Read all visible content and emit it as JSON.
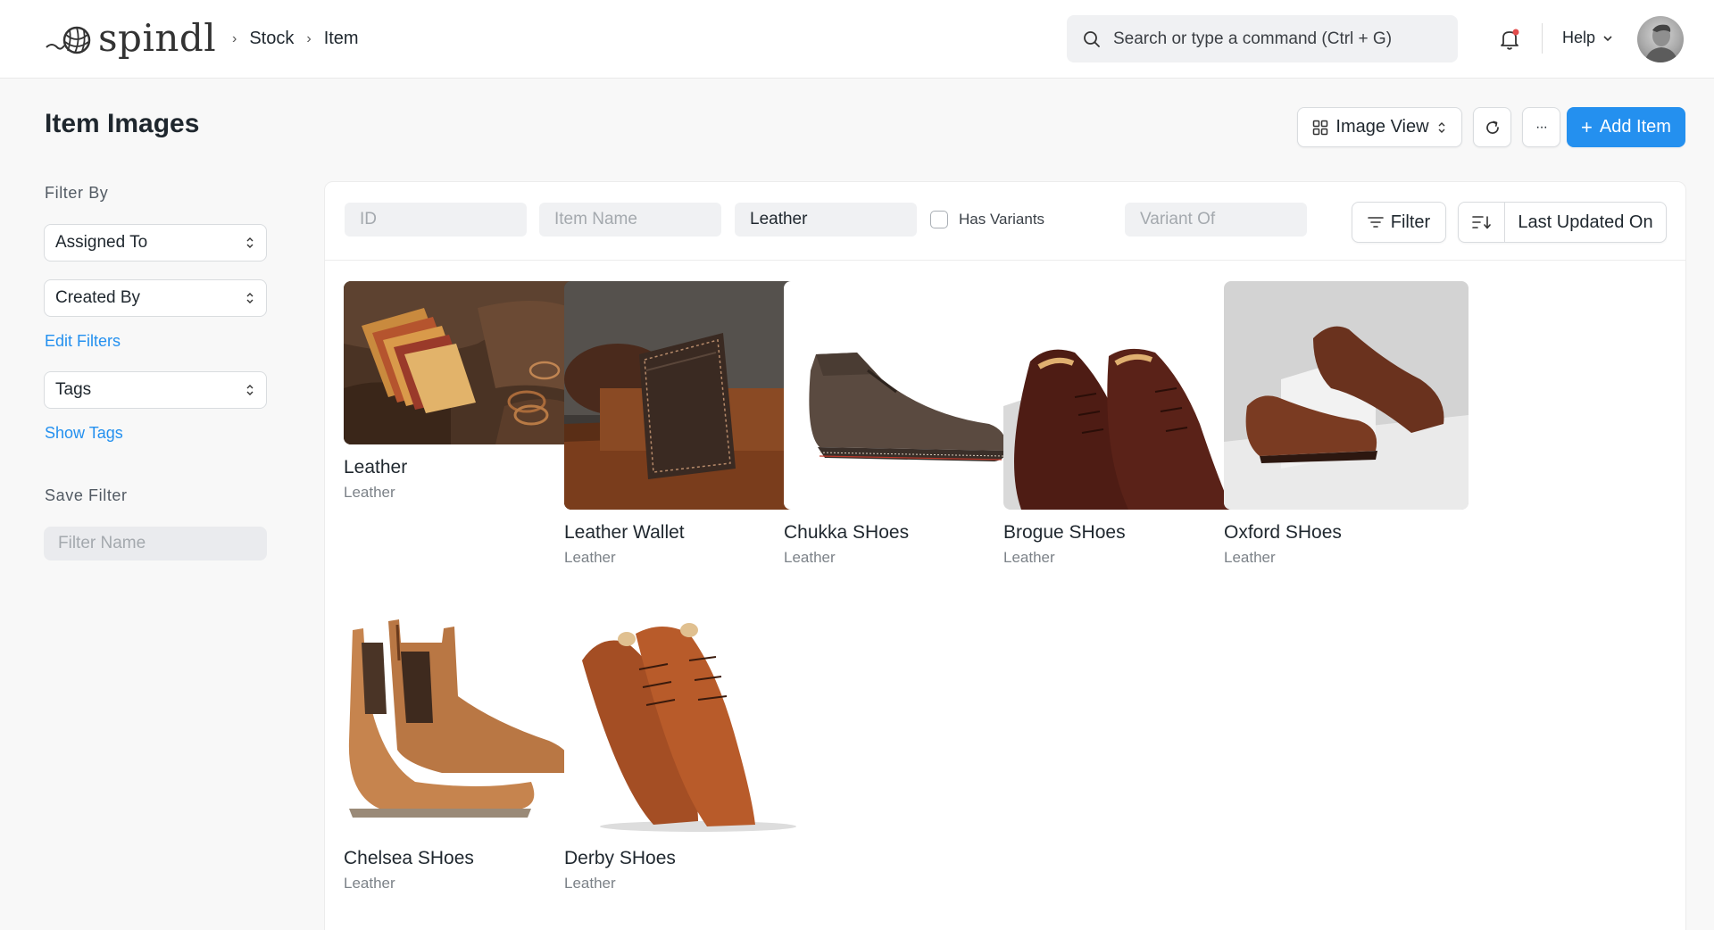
{
  "navbar": {
    "logo_text": "spindl",
    "breadcrumbs": [
      "Stock",
      "Item"
    ],
    "search_placeholder": "Search or type a command (Ctrl + G)",
    "help_label": "Help"
  },
  "page": {
    "title": "Item Images",
    "view_button": "Image View",
    "add_button": "Add Item",
    "more_label": "···",
    "accent_color": "#2490ef"
  },
  "sidebar": {
    "filter_by_label": "Filter By",
    "assigned_to": "Assigned To",
    "created_by": "Created By",
    "edit_filters": "Edit Filters",
    "tags": "Tags",
    "show_tags": "Show Tags",
    "save_filter_label": "Save Filter",
    "filter_name_placeholder": "Filter Name"
  },
  "filters": {
    "id_placeholder": "ID",
    "item_name_placeholder": "Item Name",
    "item_group_value": "Leather",
    "has_variants_label": "Has Variants",
    "variant_of_placeholder": "Variant Of",
    "filter_button": "Filter",
    "sort_by": "Last Updated On"
  },
  "items": [
    {
      "name": "Leather",
      "group": "Leather",
      "image": "leather-hides"
    },
    {
      "name": "Leather Wallet",
      "group": "Leather",
      "image": "leather-wallet"
    },
    {
      "name": "Chukka SHoes",
      "group": "Leather",
      "image": "chukka-shoes"
    },
    {
      "name": "Brogue SHoes",
      "group": "Leather",
      "image": "brogue-shoes"
    },
    {
      "name": "Oxford SHoes",
      "group": "Leather",
      "image": "oxford-shoes"
    },
    {
      "name": "Chelsea SHoes",
      "group": "Leather",
      "image": "chelsea-shoes"
    },
    {
      "name": "Derby SHoes",
      "group": "Leather",
      "image": "derby-shoes"
    }
  ]
}
